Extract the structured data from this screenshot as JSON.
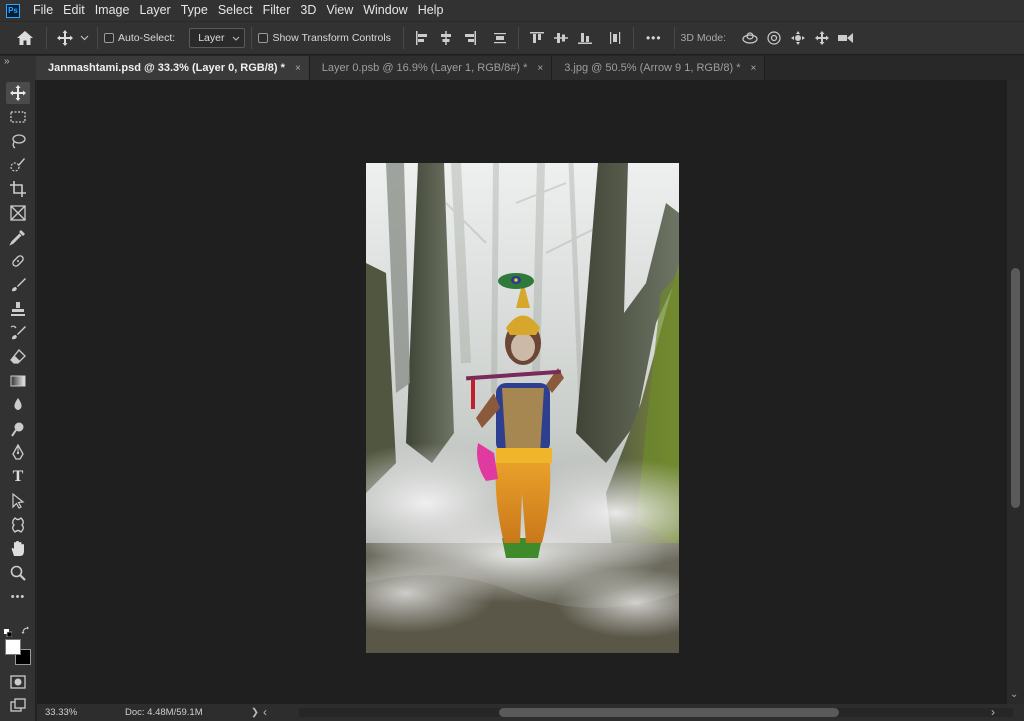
{
  "app": {
    "logo_text": "Ps",
    "accent": "#31a8ff"
  },
  "menu": {
    "items": [
      "File",
      "Edit",
      "Image",
      "Layer",
      "Type",
      "Select",
      "Filter",
      "3D",
      "View",
      "Window",
      "Help"
    ]
  },
  "options": {
    "auto_select_label": "Auto-Select:",
    "auto_select_checked": false,
    "target_value": "Layer",
    "show_transform_label": "Show Transform Controls",
    "show_transform_checked": false,
    "more_label": "•••",
    "mode_label": "3D Mode:"
  },
  "tabs": [
    {
      "title": "Janmashtami.psd @ 33.3% (Layer 0, RGB/8) *",
      "active": true
    },
    {
      "title": "Layer 0.psb @ 16.9% (Layer 1, RGB/8#) *",
      "active": false
    },
    {
      "title": "3.jpg @ 50.5% (Arrow 9 1, RGB/8) *",
      "active": false
    }
  ],
  "tab_close_glyph": "×",
  "panel_toggle": "»",
  "tools": [
    "move-tool",
    "marquee-tool",
    "lasso-tool",
    "quick-selection-tool",
    "crop-tool",
    "frame-tool",
    "eyedropper-tool",
    "healing-brush-tool",
    "brush-tool",
    "clone-stamp-tool",
    "history-brush-tool",
    "eraser-tool",
    "gradient-tool",
    "blur-tool",
    "dodge-tool",
    "pen-tool",
    "type-tool",
    "path-selection-tool",
    "custom-shape-tool",
    "hand-tool",
    "zoom-tool",
    "more-tools"
  ],
  "type_tool_glyph": "T",
  "more_tools_glyph": "•••",
  "colors": {
    "foreground": "#ffffff",
    "background": "#000000"
  },
  "status": {
    "zoom": "33.33%",
    "doc_info": "Doc: 4.48M/59.1M",
    "arrow": "❯"
  },
  "scroll_left": "‹",
  "scroll_right": "›",
  "scroll_down": "⌄"
}
